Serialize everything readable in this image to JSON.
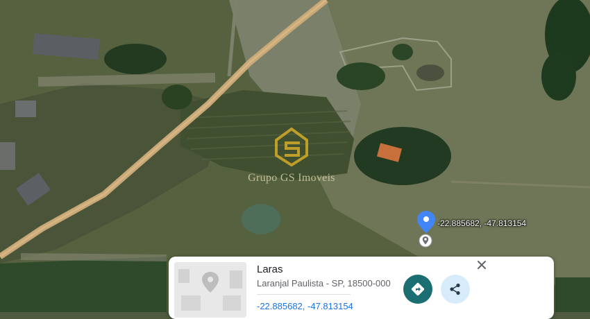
{
  "map": {
    "view": "satellite",
    "marker_coords_label": "-22.885682, -47.813154",
    "marker_icon": "map-pin-icon",
    "watermark_text": "Grupo GS Imoveis"
  },
  "place_card": {
    "title": "Laras",
    "address": "Laranjal Paulista - SP, 18500-000",
    "coordinates": "-22.885682, -47.813154",
    "thumbnail_icon": "street-view-placeholder-icon",
    "close_icon": "close-icon",
    "directions_icon": "directions-icon",
    "share_icon": "share-icon"
  },
  "colors": {
    "pin_blue": "#4285f4",
    "directions_button": "#1b6e72",
    "share_button": "#d6ecfb",
    "coordinates_link": "#1a73e8"
  }
}
